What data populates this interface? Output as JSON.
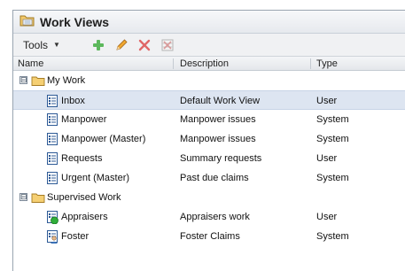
{
  "window": {
    "title": "Work Views"
  },
  "toolbar": {
    "tools_label": "Tools",
    "buttons": [
      {
        "icon": "add-icon",
        "color": "#4caf50"
      },
      {
        "icon": "pencil-icon",
        "color": "#e3a02b"
      },
      {
        "icon": "delete-icon",
        "color": "#e05a5a"
      },
      {
        "icon": "grid-delete-icon",
        "color": "#c9c9c9"
      }
    ]
  },
  "columns": {
    "name": "Name",
    "description": "Description",
    "type": "Type"
  },
  "groups": [
    {
      "label": "My Work",
      "expander": "⊟",
      "rows": [
        {
          "name": "Inbox",
          "description": "Default Work View",
          "type": "User",
          "selected": true,
          "icon": "work-view-icon"
        },
        {
          "name": "Manpower",
          "description": "Manpower issues",
          "type": "System",
          "icon": "work-view-icon"
        },
        {
          "name": "Manpower (Master)",
          "description": "Manpower issues",
          "type": "System",
          "icon": "work-view-icon"
        },
        {
          "name": "Requests",
          "description": "Summary requests",
          "type": "User",
          "icon": "work-view-icon"
        },
        {
          "name": "Urgent (Master)",
          "description": "Past due claims",
          "type": "System",
          "icon": "work-view-icon"
        }
      ]
    },
    {
      "label": "Supervised Work",
      "expander": "⊟",
      "rows": [
        {
          "name": "Appraisers",
          "description": "Appraisers work",
          "type": "User",
          "icon": "supervised-view-green-icon"
        },
        {
          "name": "Foster",
          "description": "Foster Claims",
          "type": "System",
          "icon": "supervised-view-person-icon"
        }
      ]
    }
  ]
}
